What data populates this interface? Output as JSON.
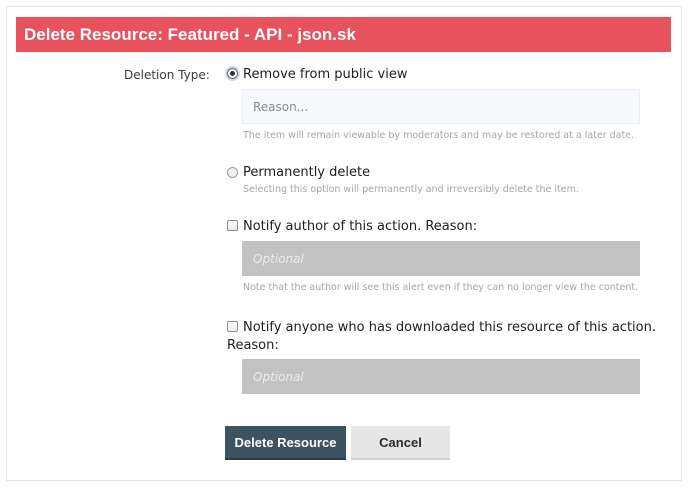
{
  "dialog": {
    "title": "Delete Resource: Featured - API - json.sk",
    "deletion_type_label": "Deletion Type:",
    "soft_delete": {
      "label": "Remove from public view",
      "reason_placeholder": "Reason...",
      "hint": "The item will remain viewable by moderators and may be restored at a later date.",
      "selected": true
    },
    "hard_delete": {
      "label": "Permanently delete",
      "hint": "Selecting this option will permanently and irreversibly delete the item.",
      "selected": false
    },
    "notify_author": {
      "label": "Notify author of this action. Reason:",
      "placeholder": "Optional",
      "hint": "Note that the author will see this alert even if they can no longer view the content.",
      "checked": false
    },
    "notify_downloaders": {
      "label_line1": "Notify anyone who has downloaded this resource of this action.",
      "label_line2": "Reason:",
      "placeholder": "Optional",
      "checked": false
    },
    "buttons": {
      "delete": "Delete Resource",
      "cancel": "Cancel"
    }
  },
  "colors": {
    "title_bar": "#e7525d",
    "primary_button": "#3e5361",
    "secondary_button": "#e6e6e6",
    "disabled_input": "#c2c2c2"
  }
}
